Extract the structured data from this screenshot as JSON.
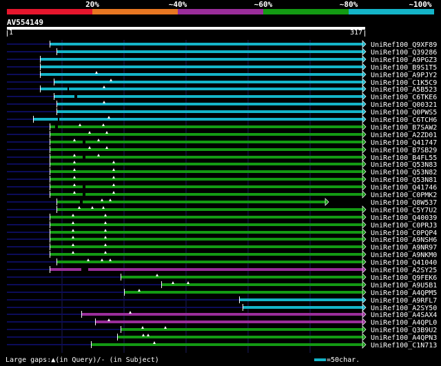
{
  "legend": {
    "labels": [
      "20%",
      "~40%",
      "~60%",
      "~80%",
      "~100%"
    ],
    "colors": [
      "#e6162d",
      "#e87722",
      "#9a2d9a",
      "#139a13",
      "#14b4c8"
    ]
  },
  "query": {
    "name": "AV554149",
    "start": "1",
    "end": "317"
  },
  "colors": {
    "cyan": "#14b4c8",
    "green": "#139a13",
    "purple": "#9a2d9a",
    "navy": "#0c0c5a",
    "grid": "#1c1c5c"
  },
  "hits": [
    {
      "name": "UniRef100_Q9XF89",
      "c": "cyan",
      "s": 72,
      "e": 526,
      "ins": [],
      "gap": []
    },
    {
      "name": "UniRef100_Q39286",
      "c": "cyan",
      "s": 82,
      "e": 526,
      "ins": [],
      "gap": []
    },
    {
      "name": "UniRef100_A9PGZ3",
      "c": "cyan",
      "s": 58,
      "e": 526,
      "ins": [],
      "gap": []
    },
    {
      "name": "UniRef100_B9S1T5",
      "c": "cyan",
      "s": 58,
      "e": 526,
      "ins": [],
      "gap": []
    },
    {
      "name": "UniRef100_A9PJY2",
      "c": "cyan",
      "s": 58,
      "e": 526,
      "ins": [
        140
      ],
      "gap": []
    },
    {
      "name": "UniRef100_C1K5C9",
      "c": "cyan",
      "s": 78,
      "e": 526,
      "ins": [
        161
      ],
      "gap": []
    },
    {
      "name": "UniRef100_A5B523",
      "c": "cyan",
      "s": 58,
      "e": 526,
      "ins": [
        151
      ],
      "gap": [
        [
          98,
          100
        ]
      ]
    },
    {
      "name": "UniRef100_C6TKE6",
      "c": "cyan",
      "s": 78,
      "e": 526,
      "ins": [],
      "gap": [
        [
          108,
          112
        ]
      ]
    },
    {
      "name": "UniRef100_Q00321",
      "c": "cyan",
      "s": 82,
      "e": 526,
      "ins": [
        151
      ],
      "gap": []
    },
    {
      "name": "UniRef100_Q0PWS5",
      "c": "cyan",
      "s": 82,
      "e": 526,
      "ins": [],
      "gap": []
    },
    {
      "name": "UniRef100_C6TCH6",
      "c": "cyan",
      "s": 48,
      "e": 526,
      "ins": [
        158
      ],
      "gap": [
        [
          84,
          86
        ]
      ]
    },
    {
      "name": "UniRef100_B7SAW2",
      "c": "green",
      "s": 72,
      "e": 526,
      "ins": [
        116,
        150
      ],
      "gap": [
        [
          80,
          84
        ]
      ]
    },
    {
      "name": "UniRef100_A2ZD01",
      "c": "green",
      "s": 72,
      "e": 526,
      "ins": [
        130,
        155
      ],
      "gap": []
    },
    {
      "name": "UniRef100_Q41747",
      "c": "green",
      "s": 72,
      "e": 526,
      "ins": [
        108,
        143
      ],
      "gap": [
        [
          120,
          124
        ]
      ]
    },
    {
      "name": "UniRef100_B7SB29",
      "c": "green",
      "s": 72,
      "e": 526,
      "ins": [
        130,
        155
      ],
      "gap": []
    },
    {
      "name": "UniRef100_B4FL55",
      "c": "green",
      "s": 72,
      "e": 526,
      "ins": [
        108,
        143
      ],
      "gap": [
        [
          120,
          124
        ]
      ]
    },
    {
      "name": "UniRef100_Q53N83",
      "c": "green",
      "s": 72,
      "e": 526,
      "ins": [
        108,
        165
      ],
      "gap": []
    },
    {
      "name": "UniRef100_Q53N82",
      "c": "green",
      "s": 72,
      "e": 526,
      "ins": [
        108,
        165
      ],
      "gap": []
    },
    {
      "name": "UniRef100_Q53N81",
      "c": "green",
      "s": 72,
      "e": 526,
      "ins": [
        108,
        165
      ],
      "gap": []
    },
    {
      "name": "UniRef100_Q41746",
      "c": "green",
      "s": 72,
      "e": 526,
      "ins": [
        108,
        165
      ],
      "gap": [
        [
          120,
          124
        ]
      ]
    },
    {
      "name": "UniRef100_C0PMK2",
      "c": "green",
      "s": 72,
      "e": 526,
      "ins": [
        108,
        165
      ],
      "gap": [
        [
          120,
          124
        ]
      ]
    },
    {
      "name": "UniRef100_Q8W537",
      "c": "green",
      "s": 82,
      "e": 472,
      "ins": [
        148,
        160
      ],
      "gap": [
        [
          116,
          120
        ]
      ]
    },
    {
      "name": "UniRef100_C5Y7U2",
      "c": "green",
      "s": 82,
      "e": 526,
      "ins": [
        115,
        134,
        150
      ],
      "gap": []
    },
    {
      "name": "UniRef100_Q40039",
      "c": "green",
      "s": 72,
      "e": 526,
      "ins": [
        106,
        153
      ],
      "gap": []
    },
    {
      "name": "UniRef100_C0PRJ3",
      "c": "green",
      "s": 72,
      "e": 526,
      "ins": [
        106,
        153
      ],
      "gap": []
    },
    {
      "name": "UniRef100_C0PQP4",
      "c": "green",
      "s": 72,
      "e": 526,
      "ins": [
        106,
        153
      ],
      "gap": []
    },
    {
      "name": "UniRef100_A9NSH6",
      "c": "green",
      "s": 72,
      "e": 526,
      "ins": [
        106,
        153
      ],
      "gap": []
    },
    {
      "name": "UniRef100_A9NR97",
      "c": "green",
      "s": 72,
      "e": 526,
      "ins": [
        106,
        153
      ],
      "gap": []
    },
    {
      "name": "UniRef100_A9NKM0",
      "c": "green",
      "s": 72,
      "e": 526,
      "ins": [
        106,
        153
      ],
      "gap": []
    },
    {
      "name": "UniRef100_Q41040",
      "c": "green",
      "s": 82,
      "e": 526,
      "ins": [
        128,
        148,
        160
      ],
      "gap": []
    },
    {
      "name": "UniRef100_A2SY25",
      "c": "purple",
      "s": 72,
      "e": 526,
      "ins": [],
      "gap": [
        [
          118,
          128
        ]
      ]
    },
    {
      "name": "UniRef100_Q9FEK6",
      "c": "green",
      "s": 175,
      "e": 526,
      "ins": [
        228
      ],
      "gap": []
    },
    {
      "name": "UniRef100_A9U5B1",
      "c": "green",
      "s": 234,
      "e": 526,
      "ins": [
        251,
        273
      ],
      "gap": []
    },
    {
      "name": "UniRef100_A4QPM5",
      "c": "green",
      "s": 180,
      "e": 526,
      "ins": [
        202
      ],
      "gap": []
    },
    {
      "name": "UniRef100_A9RFL7",
      "c": "cyan",
      "s": 347,
      "e": 526,
      "ins": [],
      "gap": []
    },
    {
      "name": "UniRef100_A2SY50",
      "c": "cyan",
      "s": 352,
      "e": 526,
      "ins": [],
      "gap": []
    },
    {
      "name": "UniRef100_A4SAX4",
      "c": "purple",
      "s": 118,
      "e": 526,
      "ins": [
        189
      ],
      "gap": []
    },
    {
      "name": "UniRef100_A4QPL0",
      "c": "purple",
      "s": 138,
      "e": 526,
      "ins": [
        158
      ],
      "gap": []
    },
    {
      "name": "UniRef100_Q3B9U2",
      "c": "green",
      "s": 175,
      "e": 526,
      "ins": [
        207,
        240
      ],
      "gap": []
    },
    {
      "name": "UniRef100_A4QPN3",
      "c": "green",
      "s": 170,
      "e": 526,
      "ins": [
        208,
        215
      ],
      "gap": []
    },
    {
      "name": "UniRef100_C1N713",
      "c": "green",
      "s": 132,
      "e": 526,
      "ins": [
        224
      ],
      "gap": []
    }
  ],
  "footer": {
    "text": "Large gaps:▲(in Query)/- (in Subject)",
    "scale": "=50char."
  }
}
